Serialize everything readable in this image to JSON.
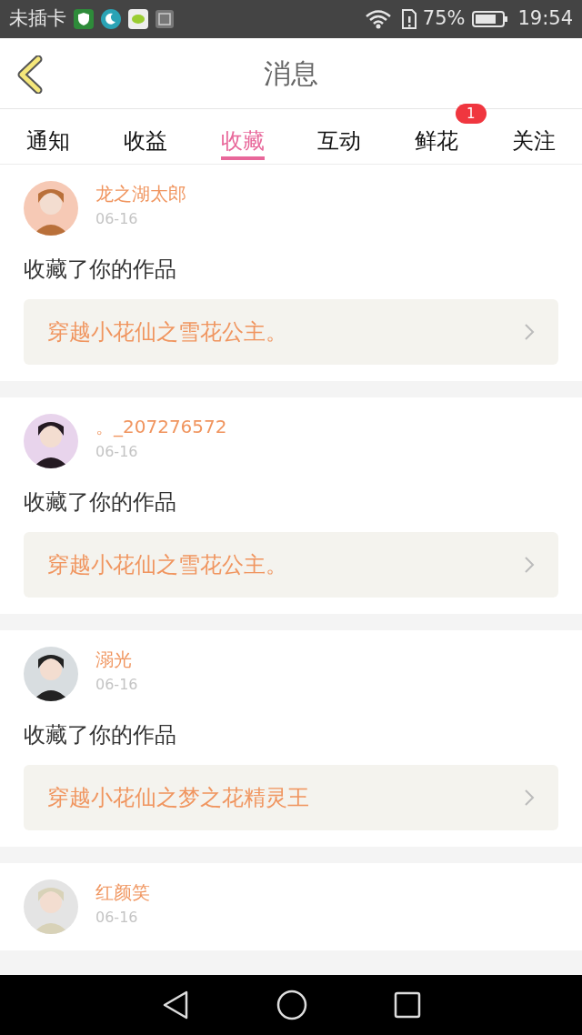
{
  "status_bar": {
    "carrier": "未插卡",
    "battery": "75%",
    "time": "19:54"
  },
  "header": {
    "title": "消息"
  },
  "tabs": [
    {
      "label": "通知",
      "selected": false
    },
    {
      "label": "收益",
      "selected": false
    },
    {
      "label": "收藏",
      "selected": true
    },
    {
      "label": "互动",
      "selected": false
    },
    {
      "label": "鲜花",
      "selected": false,
      "badge": "1"
    },
    {
      "label": "关注",
      "selected": false
    }
  ],
  "messages": [
    {
      "user": "龙之湖太郎",
      "date": "06-16",
      "action": "收藏了你的作品",
      "work": "穿越小花仙之雪花公主。"
    },
    {
      "user": "。_207276572",
      "date": "06-16",
      "action": "收藏了你的作品",
      "work": "穿越小花仙之雪花公主。"
    },
    {
      "user": "溺光",
      "date": "06-16",
      "action": "收藏了你的作品",
      "work": "穿越小花仙之梦之花精灵王"
    },
    {
      "user": "红颜笑",
      "date": "06-16"
    }
  ]
}
